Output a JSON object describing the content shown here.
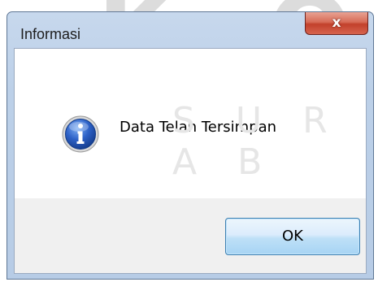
{
  "dialog": {
    "title": "Informasi",
    "message": "Data Telah Tersimpan",
    "icon": "info-icon",
    "close_button": {
      "glyph": "x",
      "icon": "close-icon"
    },
    "ok_label": "OK"
  },
  "background_watermark": {
    "large_letters": [
      "I",
      "K",
      "O"
    ],
    "subtitle_letters": "S U R A B"
  },
  "colors": {
    "frame_blue": "#bcd0e8",
    "close_red": "#c2402b",
    "footer_gray": "#f0f0f0",
    "button_blue": "#a7d4f4",
    "icon_blue": "#1f4fa8"
  }
}
